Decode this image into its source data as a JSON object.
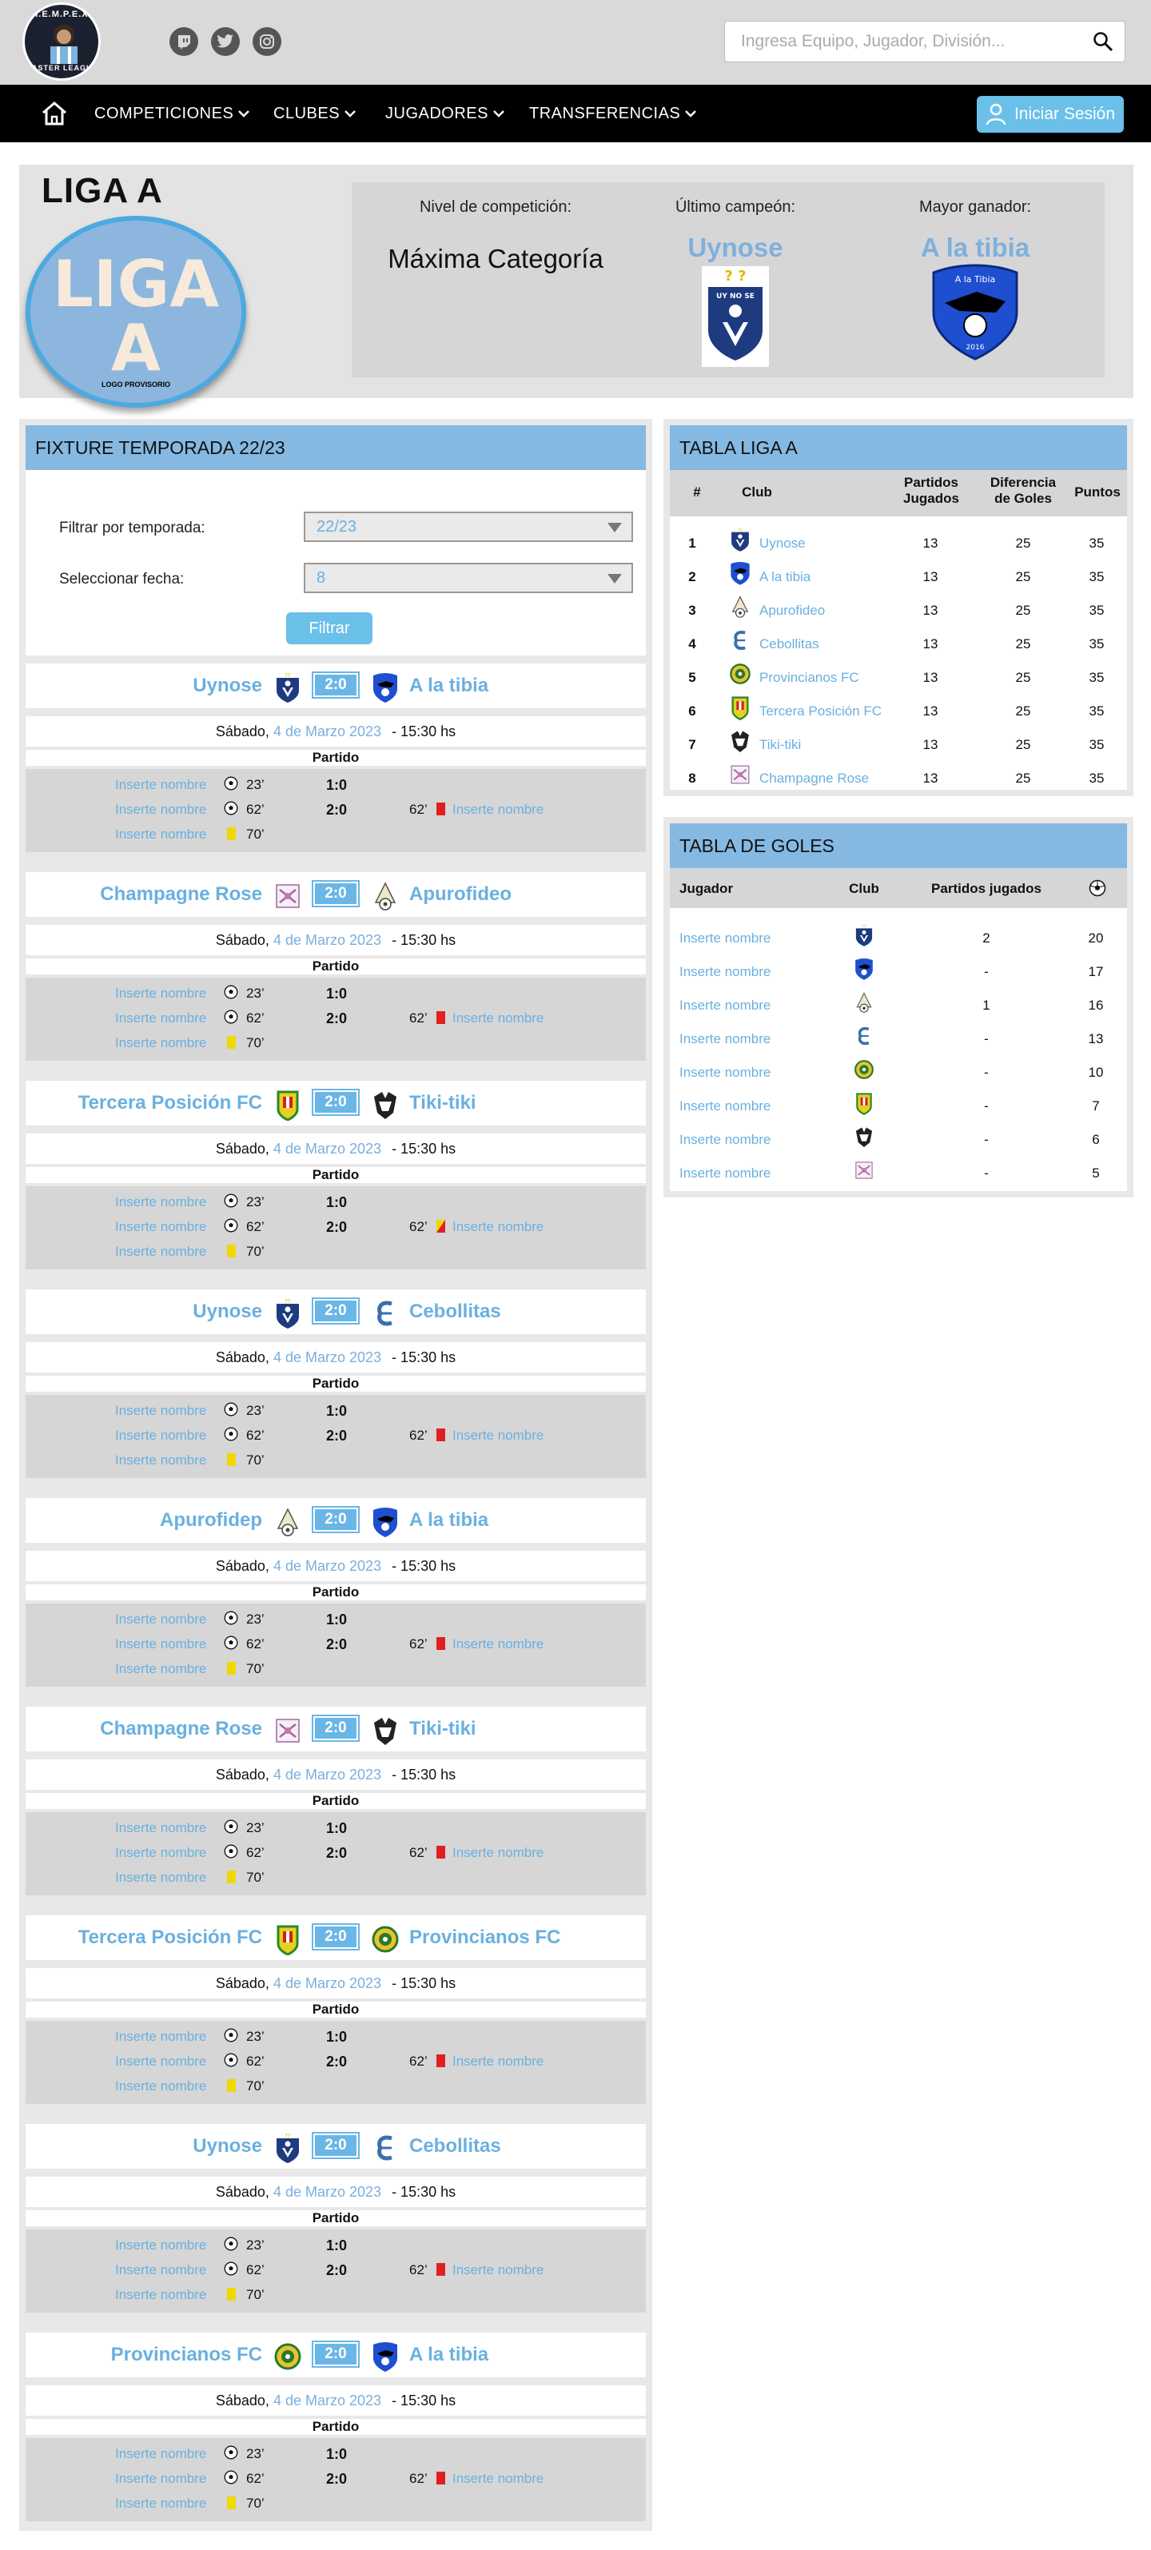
{
  "header": {
    "logo_text_top": "H.E.M.P.E.X.",
    "logo_text_bottom": "MASTER LEAGUE",
    "social_icons": [
      "twitch-icon",
      "twitter-icon",
      "instagram-icon"
    ],
    "search_placeholder": "Ingresa Equipo, Jugador, División...",
    "nav": [
      "COMPETICIONES",
      "CLUBES",
      "JUGADORES",
      "TRANSFERENCIAS"
    ],
    "login_label": "Iniciar Sesión"
  },
  "hero": {
    "title": "LIGA A",
    "logo_big_1": "LIGA",
    "logo_big_2": "A",
    "logo_small": "LOGO PROVISORIO",
    "level_label": "Nivel de competición:",
    "level_value": "Máxima Categoría",
    "champion_label": "Último campeón:",
    "champion_value": "Uynose",
    "champion_badge_text": "UY NO SE",
    "top_winner_label": "Mayor ganador:",
    "top_winner_value": "A la tibia",
    "top_winner_badge_text": "A la Tibia",
    "top_winner_badge_year": "2016"
  },
  "fixture": {
    "title": "FIXTURE TEMPORADA 22/23",
    "filter_season_label": "Filtrar por temporada:",
    "filter_season_value": "22/23",
    "filter_date_label": "Seleccionar fecha:",
    "filter_date_value": "8",
    "filter_button": "Filtrar",
    "matches": [
      {
        "home": "Uynose",
        "away": "A la tibia",
        "home_crest": "uynose",
        "away_crest": "tibia",
        "score": "2:0",
        "away_card": "red"
      },
      {
        "home": "Champagne Rose",
        "away": "Apurofideo",
        "home_crest": "champagne",
        "away_crest": "apurofideo",
        "score": "2:0",
        "away_card": "red"
      },
      {
        "home": "Tercera Posición FC",
        "away": "Tiki-tiki",
        "home_crest": "tercera",
        "away_crest": "tiki",
        "score": "2:0",
        "away_card": "redyellow"
      },
      {
        "home": "Uynose",
        "away": "Cebollitas",
        "home_crest": "uynose",
        "away_crest": "cebollitas",
        "score": "2:0",
        "away_card": "red"
      },
      {
        "home": "Apurofidep",
        "away": "A la tibia",
        "home_crest": "apurofideo",
        "away_crest": "tibia",
        "score": "2:0",
        "away_card": "red"
      },
      {
        "home": "Champagne Rose",
        "away": "Tiki-tiki",
        "home_crest": "champagne",
        "away_crest": "tiki",
        "score": "2:0",
        "away_card": "red"
      },
      {
        "home": "Tercera Posición FC",
        "away": "Provincianos FC",
        "home_crest": "tercera",
        "away_crest": "provincianos",
        "score": "2:0",
        "away_card": "red"
      },
      {
        "home": "Uynose",
        "away": "Cebollitas",
        "home_crest": "uynose",
        "away_crest": "cebollitas",
        "score": "2:0",
        "away_card": "red"
      },
      {
        "home": "Provincianos FC",
        "away": "A la tibia",
        "home_crest": "provincianos",
        "away_crest": "tibia",
        "score": "2:0",
        "away_card": "red"
      }
    ],
    "date_prefix": "Sábado,",
    "date_value": "4 de Marzo 2023",
    "time": "- 15:30 hs",
    "part_label": "Partido",
    "player_name": "Inserte nombre",
    "goal1_min": "23’",
    "goal2_min": "62’",
    "yellow_min": "70’",
    "half_score": "1:0",
    "full_score": "2:0",
    "away_card_min": "62’"
  },
  "league_table": {
    "title": "TABLA LIGA A",
    "headers": [
      "#",
      "Club",
      "Partidos Jugados",
      "Diferencia de Goles",
      "Puntos"
    ],
    "rows": [
      {
        "pos": "1",
        "club": "Uynose",
        "crest": "uynose",
        "pj": "13",
        "dg": "25",
        "pts": "35"
      },
      {
        "pos": "2",
        "club": "A la tibia",
        "crest": "tibia",
        "pj": "13",
        "dg": "25",
        "pts": "35"
      },
      {
        "pos": "3",
        "club": "Apurofideo",
        "crest": "apurofideo",
        "pj": "13",
        "dg": "25",
        "pts": "35"
      },
      {
        "pos": "4",
        "club": "Cebollitas",
        "crest": "cebollitas",
        "pj": "13",
        "dg": "25",
        "pts": "35"
      },
      {
        "pos": "5",
        "club": "Provincianos FC",
        "crest": "provincianos",
        "pj": "13",
        "dg": "25",
        "pts": "35"
      },
      {
        "pos": "6",
        "club": "Tercera Posición FC",
        "crest": "tercera",
        "pj": "13",
        "dg": "25",
        "pts": "35"
      },
      {
        "pos": "7",
        "club": "Tiki-tiki",
        "crest": "tiki",
        "pj": "13",
        "dg": "25",
        "pts": "35"
      },
      {
        "pos": "8",
        "club": "Champagne Rose",
        "crest": "champagne",
        "pj": "13",
        "dg": "25",
        "pts": "35"
      }
    ]
  },
  "goals_table": {
    "title": "TABLA DE GOLES",
    "headers": [
      "Jugador",
      "Club",
      "Partidos jugados"
    ],
    "goals_icon": "soccer-ball-icon",
    "rows": [
      {
        "player": "Inserte nombre",
        "crest": "uynose",
        "played": "2",
        "goals": "20"
      },
      {
        "player": "Inserte nombre",
        "crest": "tibia",
        "played": "-",
        "goals": "17"
      },
      {
        "player": "Inserte nombre",
        "crest": "apurofideo",
        "played": "1",
        "goals": "16"
      },
      {
        "player": "Inserte nombre",
        "crest": "cebollitas",
        "played": "-",
        "goals": "13"
      },
      {
        "player": "Inserte nombre",
        "crest": "provincianos",
        "played": "-",
        "goals": "10"
      },
      {
        "player": "Inserte nombre",
        "crest": "tercera",
        "played": "-",
        "goals": "7"
      },
      {
        "player": "Inserte nombre",
        "crest": "tiki",
        "played": "-",
        "goals": "6"
      },
      {
        "player": "Inserte nombre",
        "crest": "champagne",
        "played": "-",
        "goals": "5"
      }
    ]
  },
  "colors": {
    "accent": "#6ab0e0",
    "header_blue": "#85b9e2",
    "button": "#6ac0e8"
  }
}
